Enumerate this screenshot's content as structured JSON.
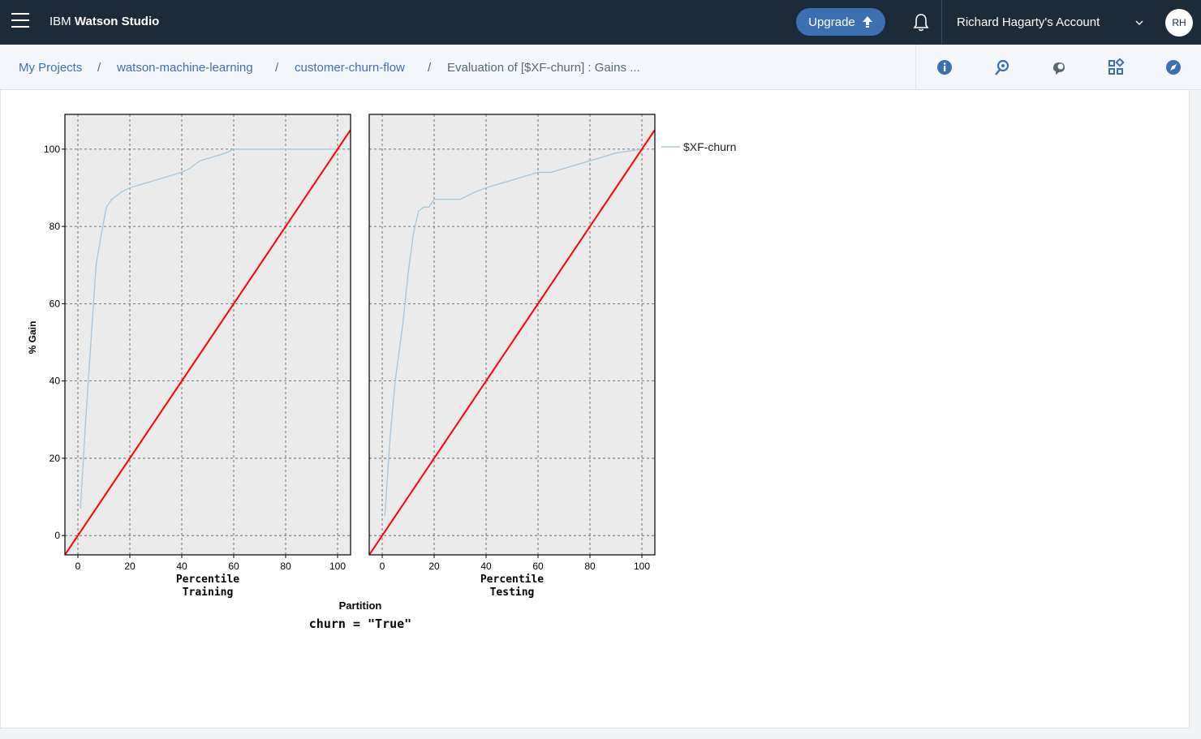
{
  "topbar": {
    "brand_prefix": "IBM",
    "brand_name": "Watson Studio",
    "upgrade_label": "Upgrade",
    "account_name": "Richard Hagarty's Account",
    "avatar_initials": "RH",
    "icons": {
      "menu": "hamburger-icon",
      "upgrade": "upload-arrow-icon",
      "notifications": "bell-icon",
      "account_menu": "chevron-down-icon"
    }
  },
  "breadcrumb": {
    "items": [
      "My Projects",
      "watson-machine-learning",
      "customer-churn-flow",
      "Evaluation of [$XF-churn] : Gains ..."
    ],
    "separator": "/"
  },
  "toolbar": {
    "icons": [
      "info-icon",
      "find-icon",
      "feedback-icon",
      "apps-icon",
      "compass-icon"
    ]
  },
  "colors": {
    "topbar": "#1c2b3a",
    "accent": "#3d70b2",
    "baseline": "#ff0000",
    "gain_line": "#a8c8de",
    "panel_bg": "#ebebeb"
  },
  "chart_data": {
    "type": "line",
    "ylabel": "% Gain",
    "xlabel": "Percentile",
    "facet_label": "Partition",
    "caption": "churn = \"True\"",
    "ylim": [
      -5,
      109
    ],
    "xlim": [
      -5,
      105
    ],
    "yticks": [
      0,
      20,
      40,
      60,
      80,
      100
    ],
    "xticks": [
      0,
      20,
      40,
      60,
      80,
      100
    ],
    "grid": true,
    "legend_position": "right",
    "panels": [
      {
        "name": "Training",
        "series": [
          {
            "name": "$XF-churn",
            "color": "#a8c8de",
            "x": [
              1,
              3,
              5,
              7,
              9,
              11,
              13,
              15,
              17,
              20,
              25,
              30,
              35,
              40,
              43,
              47,
              52,
              57,
              60,
              70,
              80,
              90,
              100
            ],
            "y": [
              7,
              30,
              50,
              70,
              78,
              85,
              87,
              88,
              89,
              90,
              91,
              92,
              93,
              94,
              95,
              97,
              98,
              99,
              100,
              100,
              100,
              100,
              100
            ]
          },
          {
            "name": "baseline",
            "color": "#ff0000",
            "x": [
              -5,
              105
            ],
            "y": [
              -5,
              105
            ]
          }
        ]
      },
      {
        "name": "Testing",
        "series": [
          {
            "name": "$XF-churn",
            "color": "#a8c8de",
            "x": [
              1,
              3,
              5,
              8,
              10,
              12,
              14,
              16,
              18,
              20,
              25,
              30,
              33,
              36,
              40,
              45,
              50,
              55,
              60,
              65,
              70,
              75,
              80,
              85,
              90,
              100
            ],
            "y": [
              5,
              25,
              40,
              55,
              68,
              78,
              84,
              85,
              85,
              87,
              87,
              87,
              88,
              89,
              90,
              91,
              92,
              93,
              94,
              94,
              95,
              96,
              97,
              98,
              99,
              100
            ]
          },
          {
            "name": "baseline",
            "color": "#ff0000",
            "x": [
              -5,
              105
            ],
            "y": [
              -5,
              105
            ]
          }
        ]
      }
    ],
    "legend": [
      "$XF-churn"
    ]
  }
}
